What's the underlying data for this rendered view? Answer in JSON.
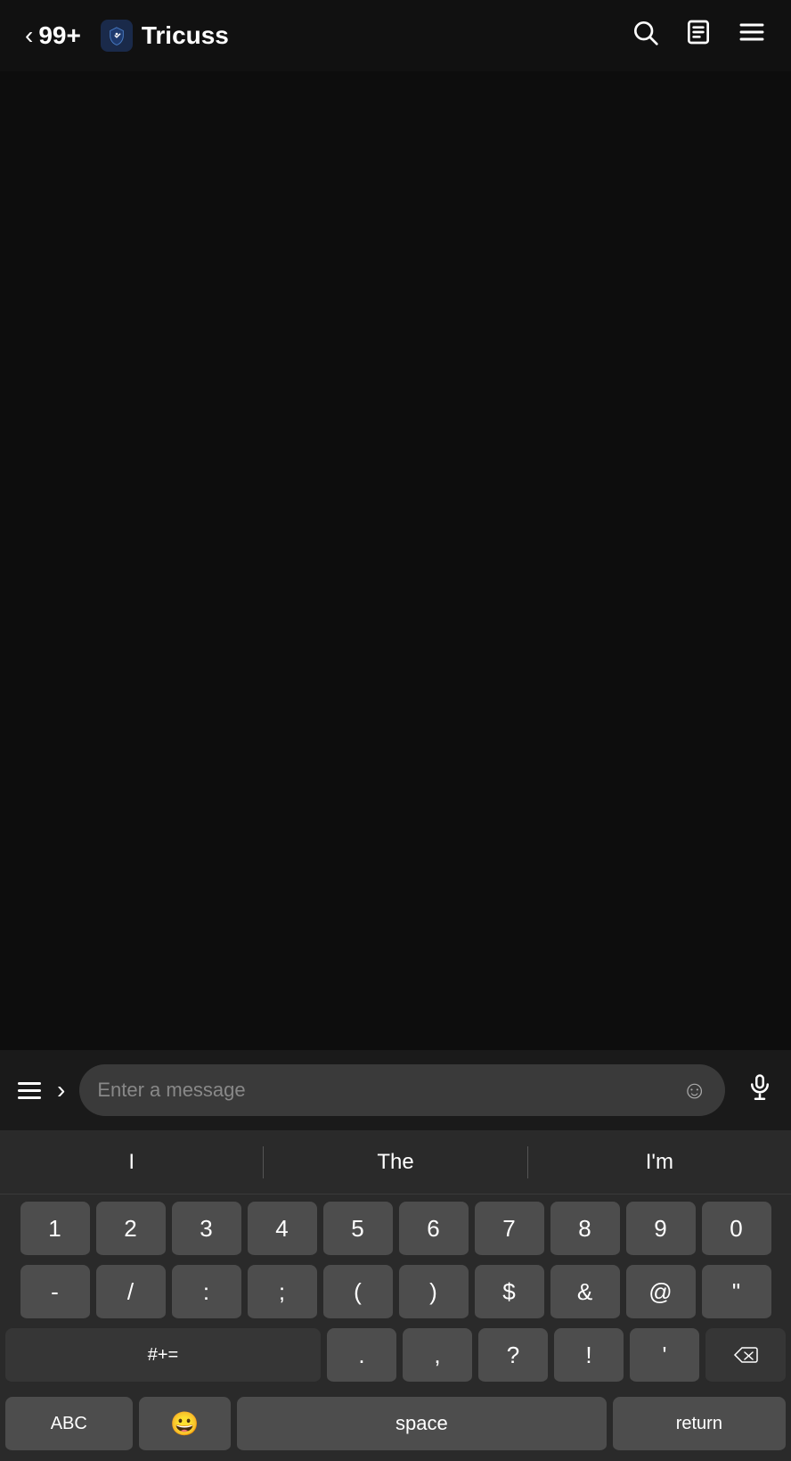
{
  "header": {
    "back_label": "99+",
    "channel_name": "Tricuss",
    "search_icon": "search-icon",
    "notes_icon": "notes-icon",
    "menu_icon": "menu-icon"
  },
  "input_bar": {
    "placeholder": "Enter a message",
    "emoji_icon": "emoji-icon",
    "mic_icon": "mic-icon",
    "hamburger_icon": "hamburger-icon",
    "arrow_icon": "arrow-icon"
  },
  "autocomplete": {
    "suggestions": [
      "I",
      "The",
      "I'm"
    ]
  },
  "keyboard": {
    "row1": [
      "1",
      "2",
      "3",
      "4",
      "5",
      "6",
      "7",
      "8",
      "9",
      "0"
    ],
    "row2": [
      "-",
      "/",
      ":",
      ";",
      "(",
      ")",
      "$",
      "&",
      "@",
      "\""
    ],
    "row3_special": "#+=",
    "row3_keys": [
      ".",
      ",",
      "?",
      "!",
      "'"
    ],
    "bottom_abc": "ABC",
    "bottom_space": "space",
    "bottom_return": "return"
  }
}
